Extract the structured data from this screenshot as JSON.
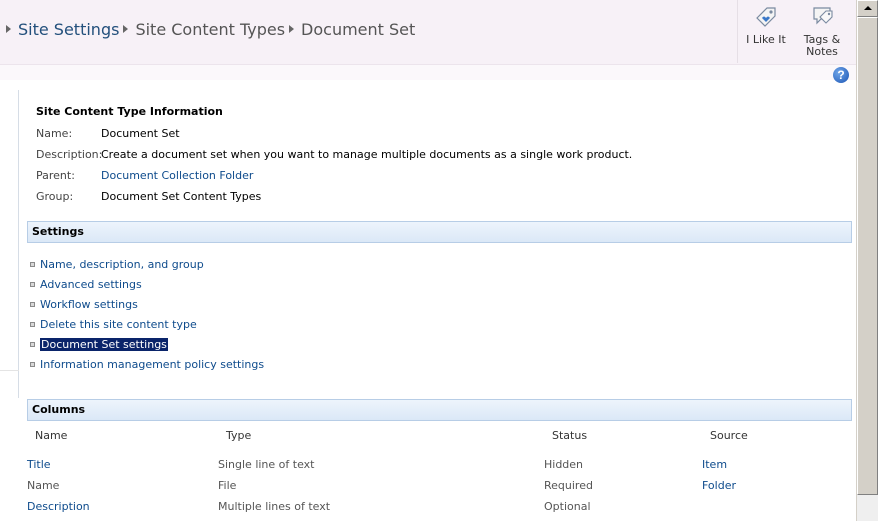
{
  "breadcrumb": [
    "Site Settings",
    "Site Content Types",
    "Document Set"
  ],
  "tools": [
    {
      "label": "I Like It",
      "icon": "like-tag-icon"
    },
    {
      "label": "Tags & Notes",
      "icon": "tags-notes-icon"
    }
  ],
  "help": {
    "icon": "help-icon",
    "glyph": "?"
  },
  "info": {
    "title": "Site Content Type Information",
    "rows": [
      {
        "label": "Name:",
        "value": "Document Set"
      },
      {
        "label": "Description:",
        "value": "Create a document set when you want to manage multiple documents as a single work product."
      },
      {
        "label": "Parent:",
        "value": "Document Collection Folder"
      },
      {
        "label": "Group:",
        "value": "Document Set Content Types"
      }
    ]
  },
  "settings": {
    "title": "Settings",
    "items": [
      "Name, description, and group",
      "Advanced settings",
      "Workflow settings",
      "Delete this site content type",
      "Document Set settings",
      "Information management policy settings"
    ],
    "selected_index": 4
  },
  "columns": {
    "title": "Columns",
    "headers": [
      "Name",
      "Type",
      "Status",
      "Source"
    ],
    "rows": [
      {
        "name": "Title",
        "type": "Single line of text",
        "status": "Hidden",
        "source": "Item"
      },
      {
        "name": "Name",
        "type": "File",
        "status": "Required",
        "source": "Folder"
      },
      {
        "name": "Description",
        "type": "Multiple lines of text",
        "status": "Optional",
        "source": ""
      }
    ]
  }
}
